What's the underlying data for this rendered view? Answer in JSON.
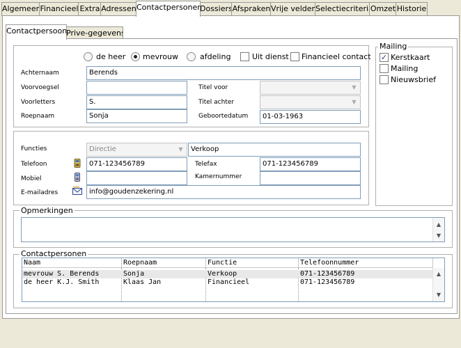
{
  "tabs": [
    {
      "label": "Algemeen"
    },
    {
      "label": "Financieel"
    },
    {
      "label": "Extra"
    },
    {
      "label": "Adressen"
    },
    {
      "label": "Contactpersonen"
    },
    {
      "label": "Dossiers"
    },
    {
      "label": "Afspraken"
    },
    {
      "label": "Vrije velden"
    },
    {
      "label": "Selectiecriteria"
    },
    {
      "label": "Omzet"
    },
    {
      "label": "Historie"
    }
  ],
  "subtabs": [
    {
      "label": "Contactpersoon"
    },
    {
      "label": "Prive-gegevens"
    }
  ],
  "salutation": {
    "options": [
      "de heer",
      "mevrouw",
      "afdeling"
    ],
    "selected": "mevrouw"
  },
  "flags": {
    "uit_dienst": {
      "label": "Uit dienst",
      "checked": false
    },
    "financieel_contact": {
      "label": "Financieel contact",
      "checked": false
    }
  },
  "person": {
    "achternaam_label": "Achternaam",
    "achternaam": "Berends",
    "voorvoegsel_label": "Voorvoegsel",
    "voorvoegsel": "",
    "voorletters_label": "Voorletters",
    "voorletters": "S.",
    "roepnaam_label": "Roepnaam",
    "roepnaam": "Sonja",
    "titel_voor_label": "Titel voor",
    "titel_voor": "",
    "titel_achter_label": "Titel achter",
    "titel_achter": "",
    "geboortedatum_label": "Geboortedatum",
    "geboortedatum": "01-03-1963"
  },
  "contact": {
    "functies_label": "Functies",
    "functie": "Directie",
    "functie_extra": "Verkoop",
    "telefoon_label": "Telefoon",
    "telefoon": "071-123456789",
    "telefax_label": "Telefax",
    "telefax": "071-123456789",
    "mobiel_label": "Mobiel",
    "mobiel": "",
    "kamernummer_label": "Kamernummer",
    "kamernummer": "",
    "email_label": "E-mailadres",
    "email": "info@goudenzekering.nl"
  },
  "mailing": {
    "title": "Mailing",
    "items": [
      {
        "label": "Kerstkaart",
        "checked": true
      },
      {
        "label": "Mailing",
        "checked": false
      },
      {
        "label": "Nieuwsbrief",
        "checked": false
      }
    ]
  },
  "opmerkingen": {
    "title": "Opmerkingen",
    "value": ""
  },
  "contactpersonen": {
    "title": "Contactpersonen",
    "columns": [
      "Naam",
      "Roepnaam",
      "Functie",
      "Telefoonnummer"
    ],
    "rows": [
      [
        "mevrouw S. Berends",
        "Sonja",
        "Verkoop",
        "071-123456789"
      ],
      [
        "de heer K.J. Smith",
        "Klaas Jan",
        "Financieel",
        "071-123456789"
      ]
    ]
  },
  "colors": {
    "bg": "#ece9d8",
    "panel": "#ffffff",
    "input_border": "#7f9db9"
  }
}
